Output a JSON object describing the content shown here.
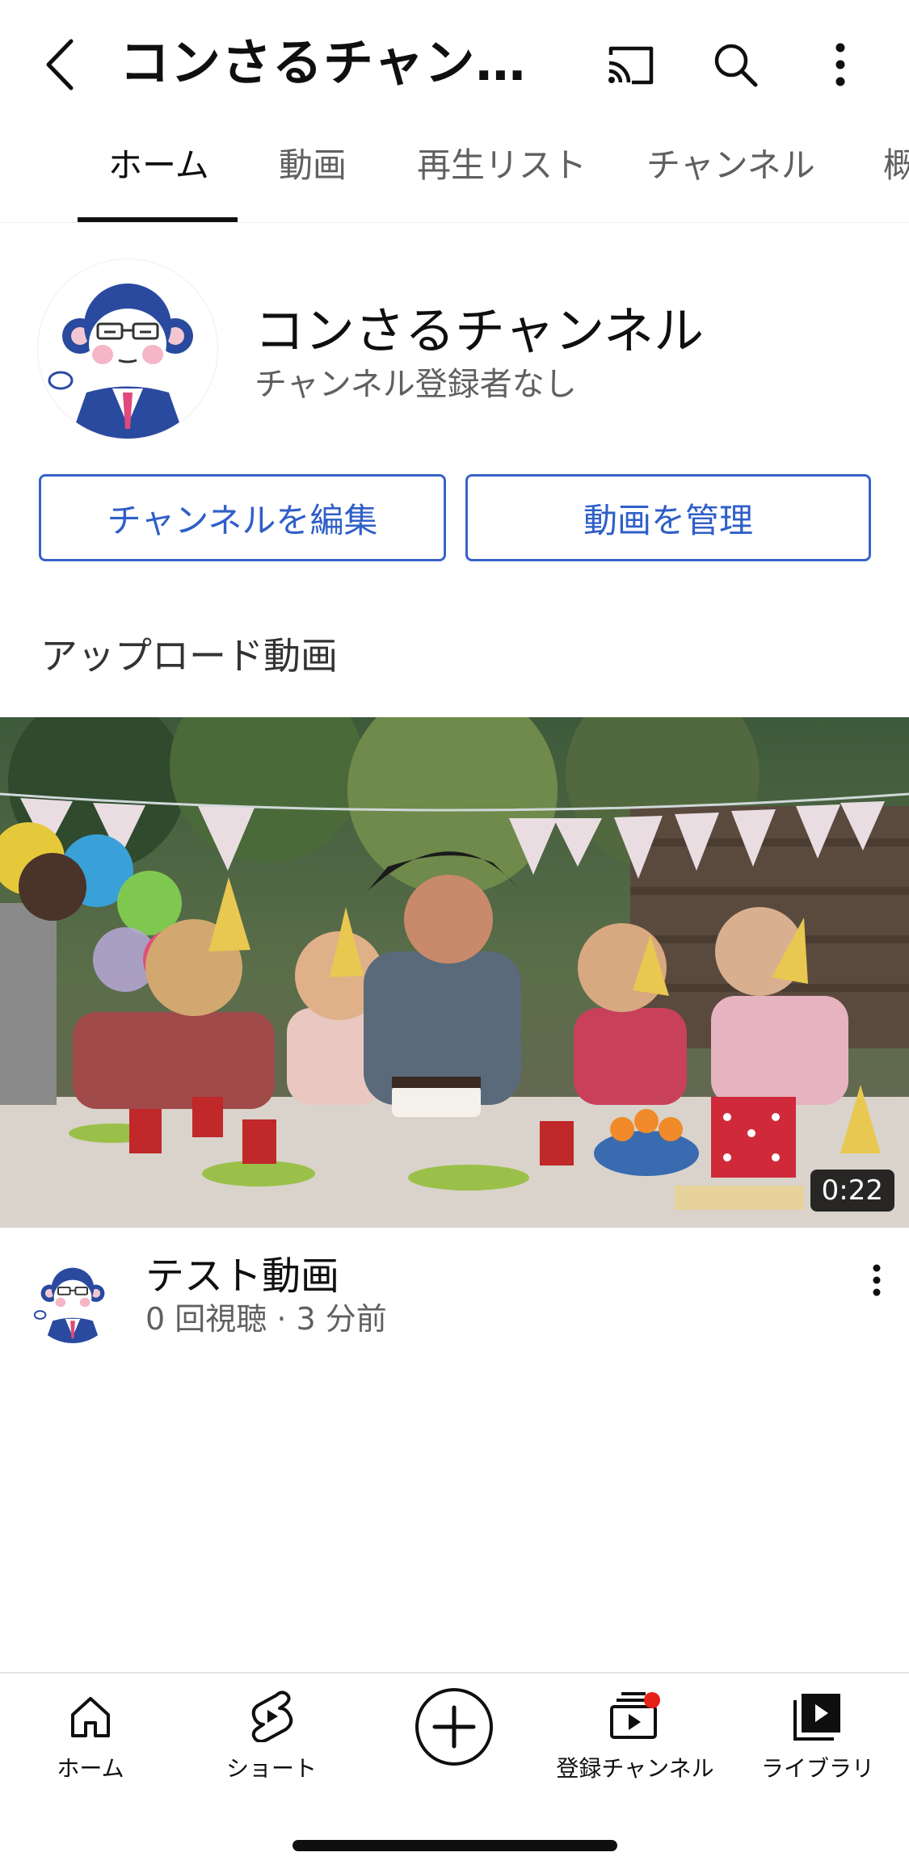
{
  "header": {
    "title": "コンさるチャン…"
  },
  "tabs": [
    {
      "label": "ホーム",
      "active": true
    },
    {
      "label": "動画"
    },
    {
      "label": "再生リスト"
    },
    {
      "label": "チャンネル"
    },
    {
      "label": "概"
    }
  ],
  "channel": {
    "name": "コンさるチャンネル",
    "subscribers": "チャンネル登録者なし",
    "edit_button": "チャンネルを編集",
    "manage_button": "動画を管理"
  },
  "uploads": {
    "heading": "アップロード動画"
  },
  "video": {
    "duration": "0:22",
    "title": "テスト動画",
    "meta": "0 回視聴 · 3 分前"
  },
  "bottom_nav": [
    {
      "label": "ホーム",
      "icon": "home-icon"
    },
    {
      "label": "ショート",
      "icon": "shorts-icon"
    },
    {
      "label": "",
      "icon": "create-icon"
    },
    {
      "label": "登録チャンネル",
      "icon": "subscriptions-icon",
      "badge_color": "#e62117"
    },
    {
      "label": "ライブラリ",
      "icon": "library-icon"
    }
  ],
  "colors": {
    "accent_blue": "#3763c9",
    "notification_dot": "#e62117"
  }
}
